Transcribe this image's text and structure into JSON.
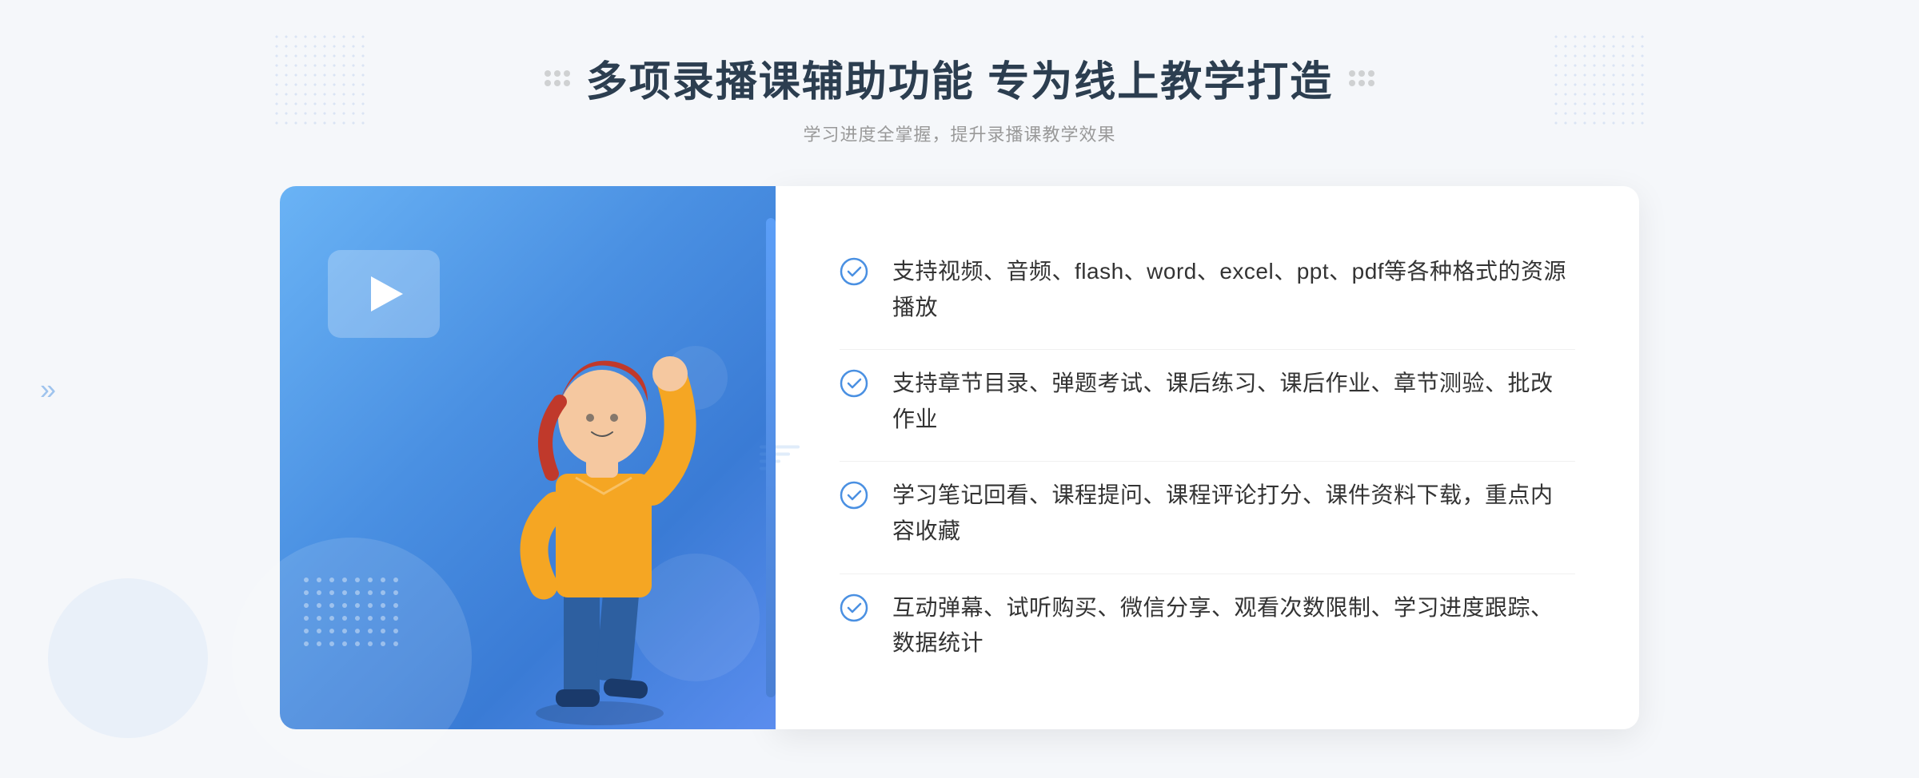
{
  "page": {
    "background_color": "#f5f7fa"
  },
  "header": {
    "title": "多项录播课辅助功能 专为线上教学打造",
    "subtitle": "学习进度全掌握，提升录播课教学效果",
    "decorator_left": "⁝⁝",
    "decorator_right": "⁝⁝"
  },
  "features": [
    {
      "id": "feature-1",
      "text": "支持视频、音频、flash、word、excel、ppt、pdf等各种格式的资源播放"
    },
    {
      "id": "feature-2",
      "text": "支持章节目录、弹题考试、课后练习、课后作业、章节测验、批改作业"
    },
    {
      "id": "feature-3",
      "text": "学习笔记回看、课程提问、课程评论打分、课件资料下载，重点内容收藏"
    },
    {
      "id": "feature-4",
      "text": "互动弹幕、试听购买、微信分享、观看次数限制、学习进度跟踪、数据统计"
    }
  ],
  "colors": {
    "primary_blue": "#4a90e2",
    "light_blue": "#6ab3f5",
    "check_color": "#4a90e2",
    "text_dark": "#2c3e50",
    "text_medium": "#333333",
    "text_light": "#999999"
  },
  "illustration": {
    "play_button": "▶",
    "dot_pattern": true
  }
}
